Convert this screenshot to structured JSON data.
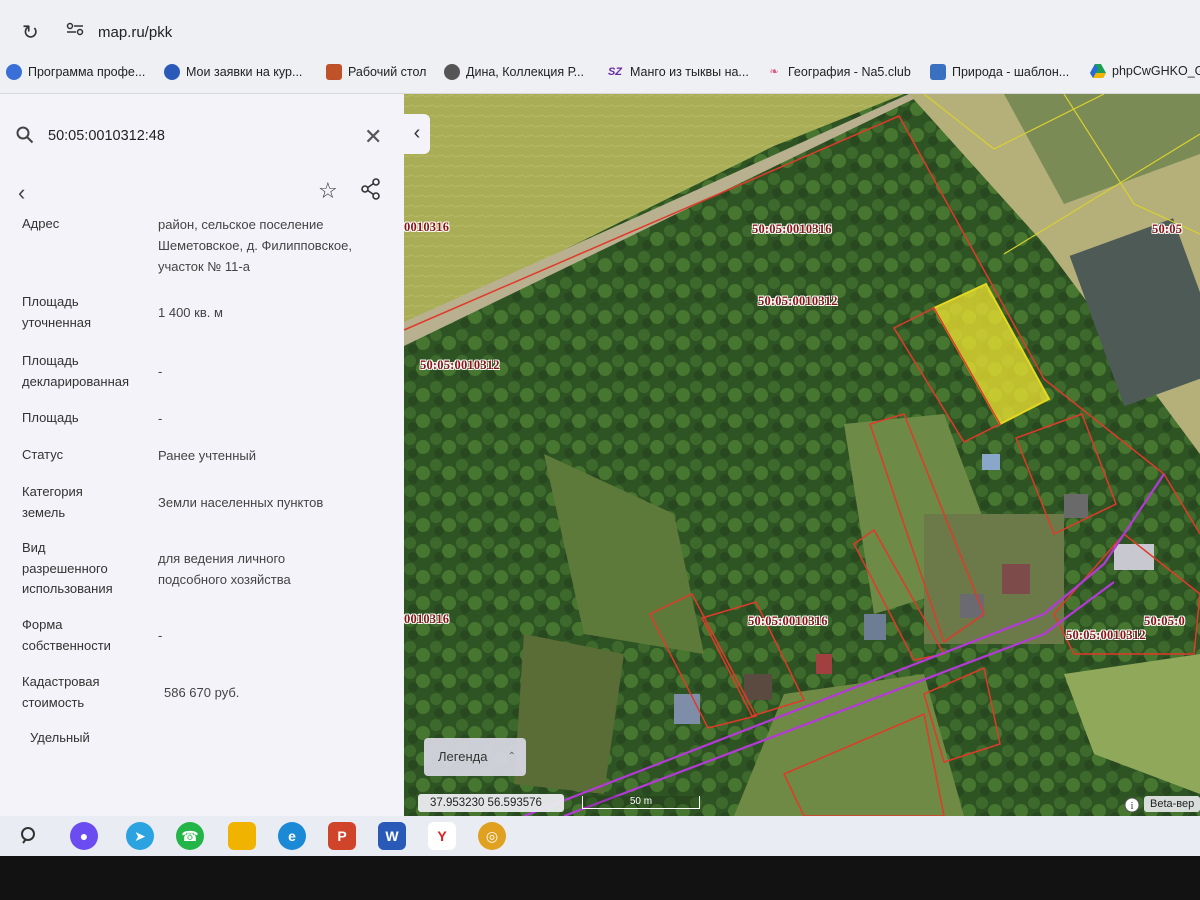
{
  "browser": {
    "url": "map.ru/pkk",
    "bookmarks": [
      {
        "label": "Программа профе...",
        "icon": "bookmark-globe-icon",
        "color": "#3a6fd8"
      },
      {
        "label": "Мои заявки на кур...",
        "icon": "bookmark-globe-icon",
        "color": "#2a5ab8"
      },
      {
        "label": "Рабочий стол",
        "icon": "bookmark-desk-icon",
        "color": "#c0522a"
      },
      {
        "label": "Дина, Коллекция Р...",
        "icon": "bookmark-globe-icon",
        "color": "#555555"
      },
      {
        "label": "Манго из тыквы на...",
        "icon": "bookmark-sz-icon",
        "color": "#6a2aa0"
      },
      {
        "label": "География - Na5.club",
        "icon": "bookmark-feather-icon",
        "color": "#e05a7a"
      },
      {
        "label": "Природа - шаблон...",
        "icon": "bookmark-slides-icon",
        "color": "#3a70c0"
      },
      {
        "label": "phpCwGHKO_G",
        "icon": "bookmark-drive-icon",
        "color": "#1a9f55"
      }
    ]
  },
  "panel": {
    "search_query": "50:05:0010312:48",
    "fields": [
      {
        "key_lines": [
          "Адрес"
        ],
        "value_lines": [
          "район, сельское поселение",
          "Шеметовское, д. Филипповское,",
          "участок № 11-а"
        ]
      },
      {
        "key_lines": [
          "Площадь",
          "уточненная"
        ],
        "value_lines": [
          "1 400 кв. м"
        ]
      },
      {
        "key_lines": [
          "Площадь",
          "декларированная"
        ],
        "value_lines": [
          "-"
        ]
      },
      {
        "key_lines": [
          "Площадь"
        ],
        "value_lines": [
          "-"
        ]
      },
      {
        "key_lines": [
          "Статус"
        ],
        "value_lines": [
          "Ранее учтенный"
        ]
      },
      {
        "key_lines": [
          "Категория",
          "земель"
        ],
        "value_lines": [
          "Земли населенных пунктов"
        ]
      },
      {
        "key_lines": [
          "Вид",
          "разрешенного",
          "использования"
        ],
        "value_lines": [
          "для ведения личного",
          "подсобного хозяйства"
        ]
      },
      {
        "key_lines": [
          "Форма",
          "собственности"
        ],
        "value_lines": [
          "-"
        ]
      },
      {
        "key_lines": [
          "Кадастровая",
          "стоимость"
        ],
        "value_lines": [
          "586 670 руб."
        ]
      },
      {
        "key_lines": [
          "Удельный"
        ],
        "value_lines": []
      }
    ]
  },
  "map": {
    "labels": [
      "0010316",
      "50:05:0010316",
      "50:05:0010312",
      "50:05:0010312",
      "0010316",
      "50:05:0010316",
      "50:05:0010312",
      "50:05",
      "50:05:0"
    ],
    "legend_label": "Легенда",
    "coordinates": "37.953230   56.593576",
    "scale_label": "50 m",
    "beta_label": "Beta-вер",
    "parcel_highlight_color": "#f2e431",
    "boundary_color": "#e03a2a"
  },
  "taskbar": {
    "apps": [
      {
        "icon": "search-icon"
      },
      {
        "icon": "alice-icon",
        "color": "#6a4cf0"
      },
      {
        "icon": "telegram-icon",
        "color": "#2aa3e0"
      },
      {
        "icon": "whatsapp-icon",
        "color": "#24b548"
      },
      {
        "icon": "file-explorer-icon",
        "color": "#f0b400"
      },
      {
        "icon": "edge-icon",
        "color": "#1b8ad6"
      },
      {
        "icon": "powerpoint-icon",
        "color": "#d0452a"
      },
      {
        "icon": "word-icon",
        "color": "#2a5ab8"
      },
      {
        "icon": "yandex-browser-icon",
        "color": "#ffffff"
      },
      {
        "icon": "chrome-icon",
        "color": "#e0a020"
      }
    ]
  }
}
